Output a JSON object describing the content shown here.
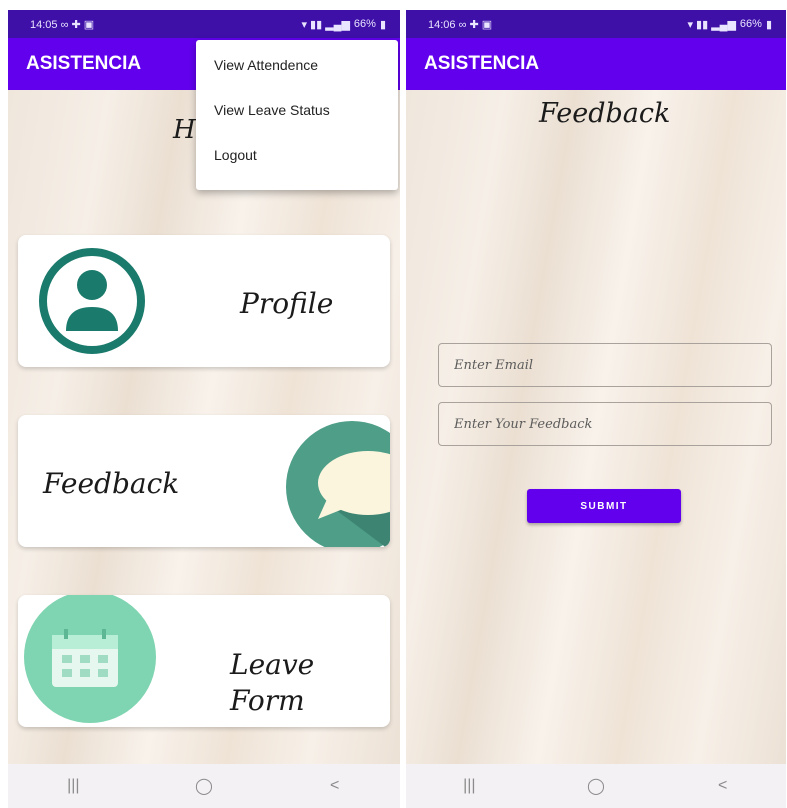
{
  "colors": {
    "app_bar": "#6200ee",
    "status_bar": "#3e10a8",
    "profile_icon": "#1a7a6c",
    "feedback_icon": "#4e9e88",
    "leave_icon": "#7fd4b1"
  },
  "left_screen": {
    "status_bar": {
      "time": "14:05 ∞ ✚ ▣",
      "battery": "66%"
    },
    "app_title": "ASISTENCIA",
    "home_title": "Ho",
    "menu": [
      {
        "label": "View Attendence"
      },
      {
        "label": "View Leave Status"
      },
      {
        "label": "Logout"
      }
    ],
    "cards": {
      "profile": {
        "label": "Profile",
        "icon": "profile-icon"
      },
      "feedback": {
        "label": "Feedback",
        "icon": "chat-bubble-icon"
      },
      "leave": {
        "label_line1": "Leave",
        "label_line2": "Form",
        "icon": "calendar-icon"
      }
    },
    "nav": {
      "recents": "|||",
      "home": "◯",
      "back": "<"
    }
  },
  "right_screen": {
    "status_bar": {
      "time": "14:06 ∞ ✚ ▣",
      "battery": "66%"
    },
    "app_title": "ASISTENCIA",
    "page_title": "Feedback",
    "email": {
      "placeholder": "Enter Email"
    },
    "feedback": {
      "placeholder": "Enter Your Feedback"
    },
    "submit_label": "SUBMIT",
    "nav": {
      "recents": "|||",
      "home": "◯",
      "back": "<"
    }
  }
}
